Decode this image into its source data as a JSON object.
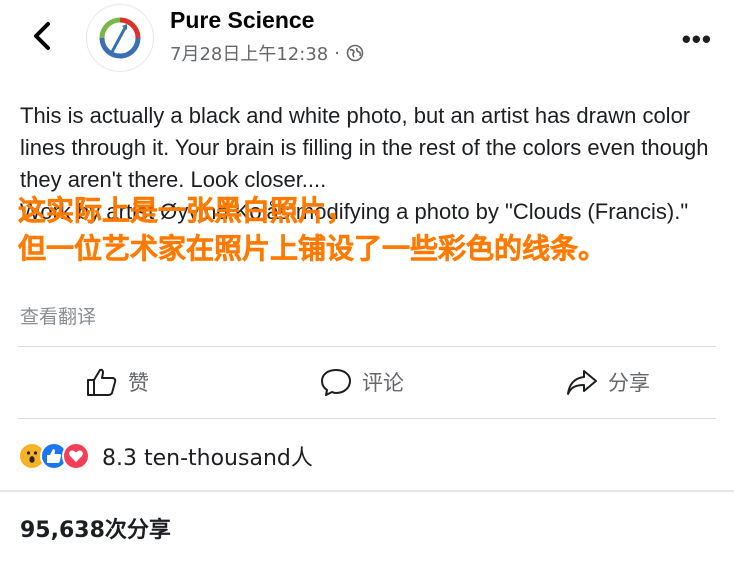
{
  "header": {
    "page_name": "Pure Science",
    "timestamp": "7月28日上午12:38",
    "separator": "·",
    "privacy_icon": "globe-icon",
    "back_icon": "chevron-left-icon",
    "more_icon": "more-horizontal-icon",
    "more_label": "•••"
  },
  "post": {
    "text_line1": "This is actually a black and white photo, but an artist has drawn color lines through it. Your brain is filling in the rest of the colors even though they aren't there. Look closer....",
    "text_line2": "Work by artist Øyvind Kolås modifying a photo by \"Clouds (Francis).\"",
    "translate_link": "查看翻译"
  },
  "overlay_caption": {
    "line1": "这实际上是一张黑白照片，",
    "line2": "但一位艺术家在照片上铺设了一些彩色的线条。",
    "color": "#ff7a00"
  },
  "actions": {
    "like_label": "赞",
    "like_icon": "thumbs-up-icon",
    "comment_label": "评论",
    "comment_icon": "comment-icon",
    "share_label": "分享",
    "share_icon": "share-icon"
  },
  "reactions": {
    "icons": [
      "wow-icon",
      "like-icon",
      "love-icon"
    ],
    "count_text": "8.3 ten-thousand人"
  },
  "shares": {
    "text": "95,638次分享"
  },
  "colors": {
    "secondary_text": "#65676b",
    "like_blue": "#1877f2",
    "love_red": "#f33e58",
    "wow_yellow": "#f7b125"
  }
}
